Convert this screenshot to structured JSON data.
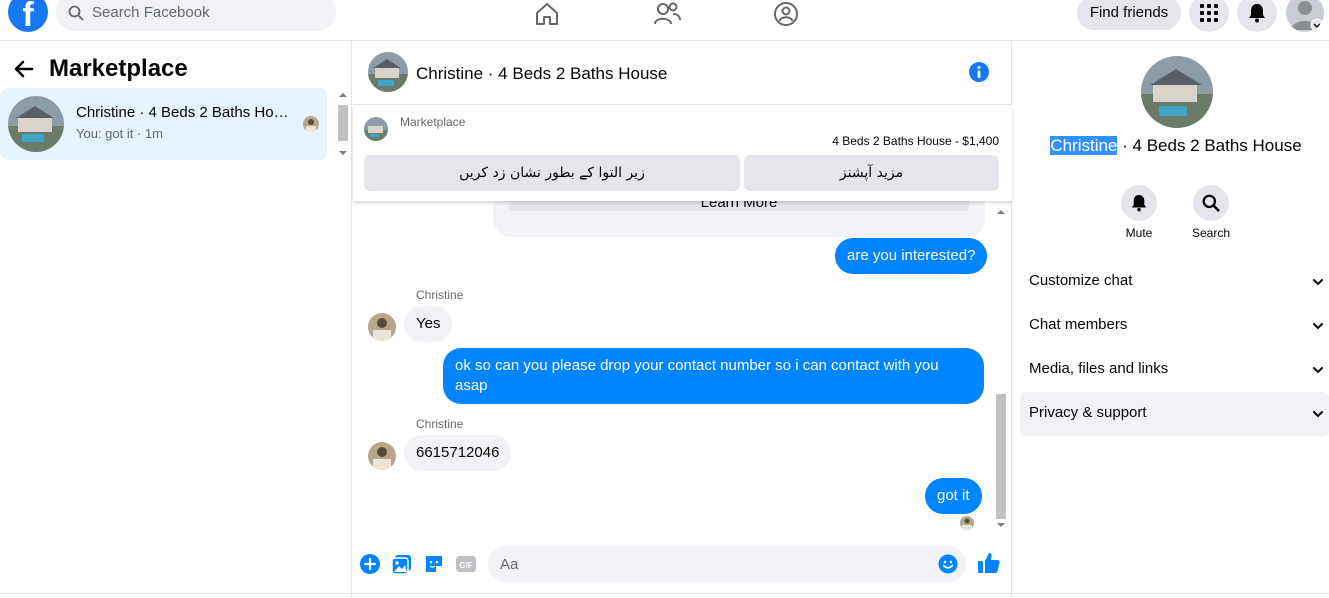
{
  "top_nav": {
    "logo": "f",
    "search_placeholder": "Search Facebook",
    "icons": [
      "home-icon",
      "friends-icon",
      "groups-icon"
    ],
    "find_friends": "Find friends",
    "right_icons": [
      "menu-grid-icon",
      "bell-icon",
      "account-avatar"
    ]
  },
  "sidebar": {
    "title": "Marketplace",
    "conversations": [
      {
        "name": "Christine · 4 Beds 2 Baths House",
        "preview": "You: got it · 1m",
        "selected": true
      }
    ]
  },
  "chat": {
    "header_title": "Christine · 4 Beds 2 Baths House",
    "listing": {
      "label": "Marketplace",
      "price_line": "4 Beds 2 Baths House - $1,400",
      "button_left": "زیر التوا کے بطور نشان زد کریں",
      "button_right": "مزید آپشنز"
    },
    "learn_more": "Learn More",
    "messages": [
      {
        "from": "me",
        "text": "are you interested?"
      },
      {
        "from": "them",
        "sender": "Christine",
        "text": "Yes"
      },
      {
        "from": "me",
        "text": "ok so can you please drop your contact number so i can contact with you asap"
      },
      {
        "from": "them",
        "sender": "Christine",
        "text": "6615712046"
      },
      {
        "from": "me",
        "text": "got it"
      }
    ],
    "composer_placeholder": "Aa"
  },
  "details": {
    "name_highlight": "Christine",
    "name_rest": " · 4 Beds 2 Baths House",
    "actions": [
      {
        "label": "Mute",
        "icon": "bell-icon"
      },
      {
        "label": "Search",
        "icon": "search-icon"
      }
    ],
    "menu": [
      {
        "label": "Customize chat"
      },
      {
        "label": "Chat members"
      },
      {
        "label": "Media, files and links"
      },
      {
        "label": "Privacy & support"
      }
    ]
  },
  "colors": {
    "brand": "#1877f2",
    "bubble_out": "#0084ff",
    "bubble_in": "#f0f2f5",
    "selected_bg": "#e7f3ff",
    "highlight": "#3390ff"
  }
}
